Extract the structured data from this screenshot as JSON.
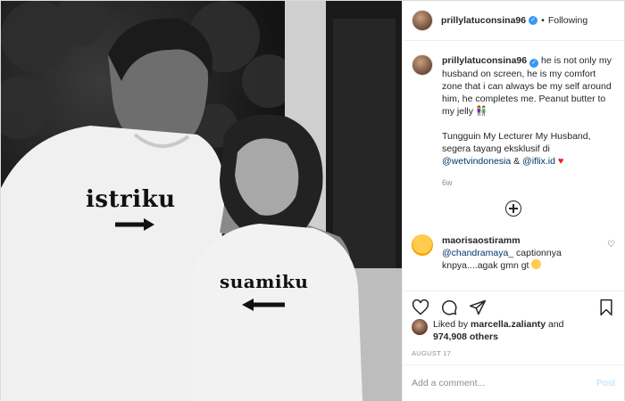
{
  "header": {
    "username": "prillylatuconsina96",
    "separator": "•",
    "follow_label": "Following"
  },
  "photo": {
    "shirt_left_text": "istriku",
    "shirt_right_text": "suamiku"
  },
  "caption": {
    "username": "prillylatuconsina96",
    "text_1": " he is not only my husband on screen, he is my comfort zone that i can always be my self around him, he completes me. Peanut butter to my jelly 👫",
    "text_2": "Tungguin My Lecturer My Husband, segera tayang eksklusif di ",
    "mention_1": "@wetvindonesia",
    "amp": " & ",
    "mention_2": "@iflix.id",
    "heart": "♥",
    "time_ago": "6w"
  },
  "comment": {
    "username": "maorisaostiramm",
    "mention": "@chandramaya_",
    "text": " captionnya knpya....agak gmn gt",
    "heart": "♡"
  },
  "likes": {
    "prefix": "Liked by ",
    "liker": "marcella.zalianty",
    "and": " and",
    "count": "974,908 others"
  },
  "date": "AUGUST 17",
  "add_comment": {
    "placeholder": "Add a comment...",
    "post_label": "Post"
  },
  "icons": [
    "heart-icon",
    "comment-icon",
    "share-icon",
    "bookmark-icon",
    "plus-circle-icon",
    "verified-badge-icon"
  ]
}
